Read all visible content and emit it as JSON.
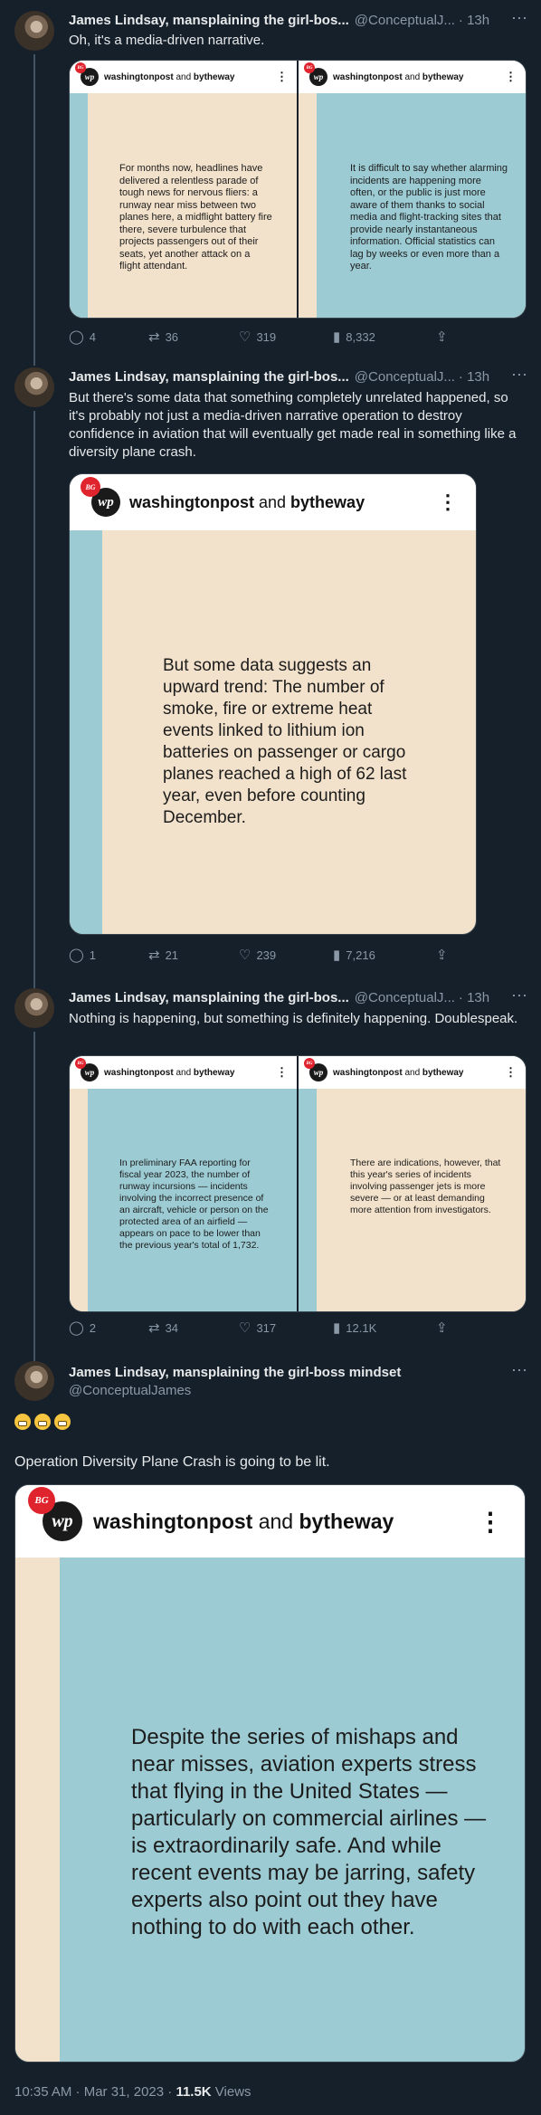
{
  "tweets": [
    {
      "author_name": "James Lindsay, mansplaining the girl-bos...",
      "handle": "@ConceptualJ...",
      "time": "· 13h",
      "text": "Oh, it's a media-driven narrative.",
      "media": [
        {
          "brand_main": "washingtonpost",
          "brand_and": " and ",
          "brand_second": "bytheway",
          "quote": "For months now, headlines have delivered a relentless parade of tough news for nervous fliers: a runway near miss between two planes here, a midflight battery fire there, severe turbulence that projects passengers out of their seats, yet another attack on a flight attendant."
        },
        {
          "brand_main": "washingtonpost",
          "brand_and": " and ",
          "brand_second": "bytheway",
          "quote": "It is difficult to say whether alarming incidents are happening more often, or the public is just more aware of them thanks to social media and flight-tracking sites that provide nearly instantaneous information. Official statistics can lag by weeks or even more than a year."
        }
      ],
      "replies": "4",
      "retweets": "36",
      "likes": "319",
      "views": "8,332"
    },
    {
      "author_name": "James Lindsay, mansplaining the girl-bos...",
      "handle": "@ConceptualJ...",
      "time": "· 13h",
      "text": "But there's some data that something completely unrelated happened, so it's probably not just a media-driven narrative operation to destroy confidence in aviation that will eventually get made real in something like a diversity plane crash.",
      "media": [
        {
          "brand_main": "washingtonpost",
          "brand_and": " and ",
          "brand_second": "bytheway",
          "quote": "But some data suggests an upward trend: The number of smoke, fire or extreme heat events linked to lithium ion batteries on passenger or cargo planes reached a high of 62 last year, even before counting December."
        }
      ],
      "replies": "1",
      "retweets": "21",
      "likes": "239",
      "views": "7,216"
    },
    {
      "author_name": "James Lindsay, mansplaining the girl-bos...",
      "handle": "@ConceptualJ...",
      "time": "· 13h",
      "text": "Nothing is happening, but something is definitely happening. Doublespeak.",
      "media": [
        {
          "brand_main": "washingtonpost",
          "brand_and": " and ",
          "brand_second": "bytheway",
          "quote": "In preliminary FAA reporting for fiscal year 2023, the number of runway incursions — incidents involving the incorrect presence of an aircraft, vehicle or person on the protected area of an airfield — appears on pace to be lower than the previous year's total of 1,732."
        },
        {
          "brand_main": "washingtonpost",
          "brand_and": " and ",
          "brand_second": "bytheway",
          "quote": "There are indications, however, that this year's series of incidents involving passenger jets is more severe — or at least demanding more attention from investigators."
        }
      ],
      "replies": "2",
      "retweets": "34",
      "likes": "317",
      "views": "12.1K"
    }
  ],
  "main_tweet": {
    "author_name": "James Lindsay, mansplaining the girl-boss mindset",
    "handle": "@ConceptualJames",
    "text": "Operation Diversity Plane Crash is going to be lit.",
    "media": {
      "brand_main": "washingtonpost",
      "brand_and": " and ",
      "brand_second": "bytheway",
      "quote": "Despite the series of mishaps and near misses, aviation experts stress that flying in the United States — particularly on commercial airlines — is extraordinarily safe. And while recent events may be jarring, safety experts also point out they have nothing to do with each other."
    },
    "timestamp": "10:35 AM · Mar 31, 2023 · ",
    "views_count": "11.5K",
    "views_label": " Views"
  },
  "icons": {
    "more": "⋯",
    "reply": "◯",
    "retweet": "⇄",
    "like": "♡",
    "views": "▮",
    "share": "⇪",
    "logo_text": "wp",
    "badge_text": "BG",
    "card_dots": "⋮"
  },
  "colors": {
    "bg": "#15202b",
    "beige": "#f3e2cb",
    "blue": "#9ccbd3",
    "badge_red": "#e0242e",
    "muted": "#8b98a5"
  }
}
